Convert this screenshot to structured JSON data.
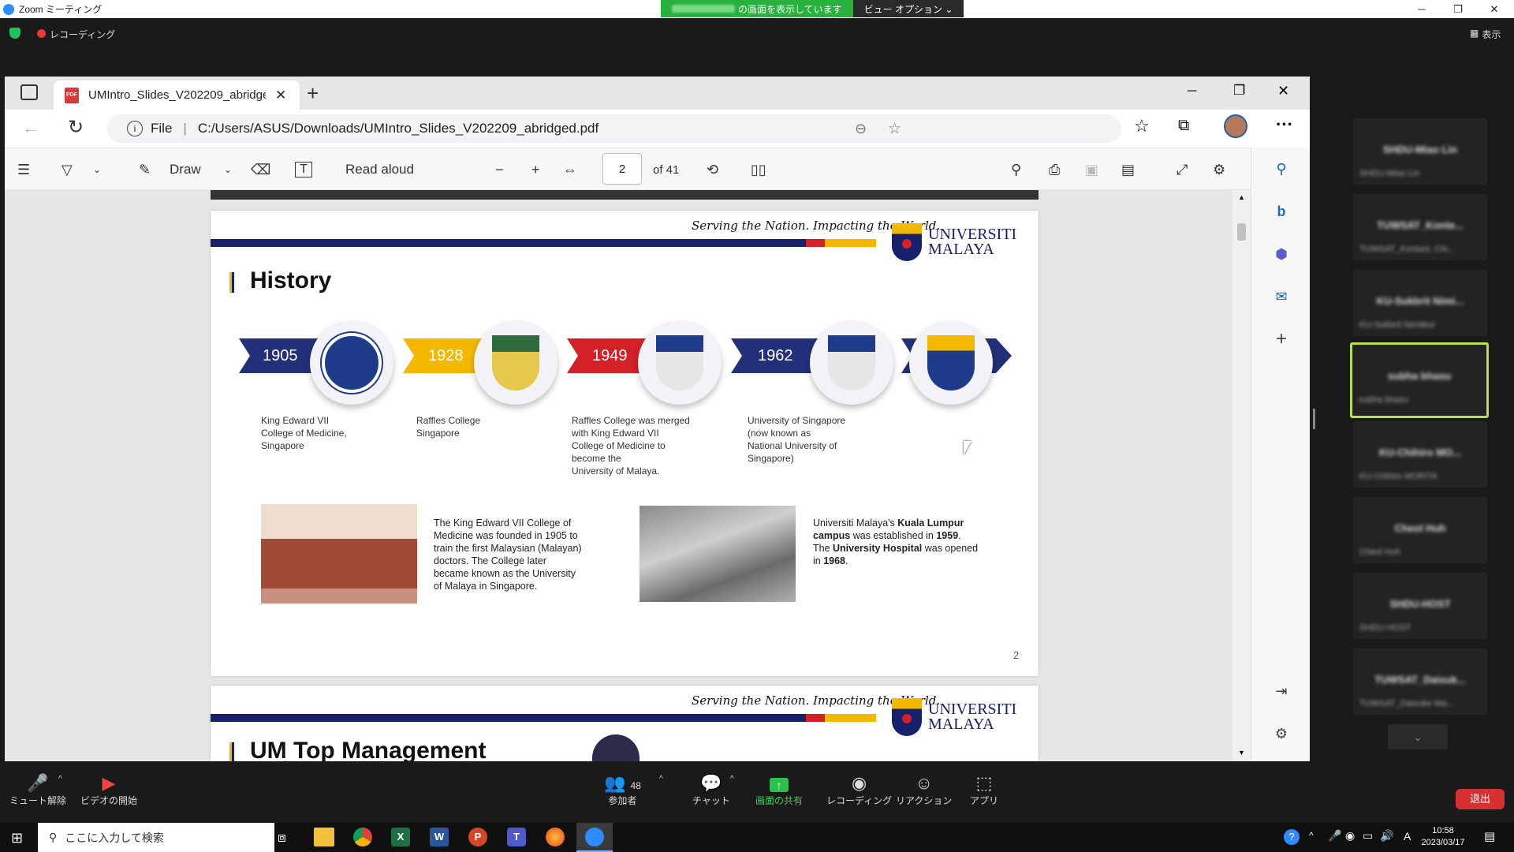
{
  "zoom": {
    "window_title": "Zoom ミーティング",
    "share_banner_suffix": "の画面を表示しています",
    "view_options": "ビュー オプション ⌄",
    "recording": "レコーディング",
    "view_label": "表示",
    "leave": "退出",
    "participants_count": "48",
    "toolbar": [
      {
        "label": "ミュート解除",
        "icon": "microphone-muted-icon"
      },
      {
        "label": "ビデオの開始",
        "icon": "video-off-icon"
      },
      {
        "label": "参加者",
        "icon": "participants-icon"
      },
      {
        "label": "チャット",
        "icon": "chat-icon"
      },
      {
        "label": "画面の共有",
        "icon": "share-screen-icon"
      },
      {
        "label": "レコーディング",
        "icon": "record-icon"
      },
      {
        "label": "リアクション",
        "icon": "reaction-icon"
      },
      {
        "label": "アプリ",
        "icon": "apps-icon"
      }
    ],
    "participants": [
      {
        "name": "SHDU-Miao Lin",
        "sub": "SHDU-Miao Lin"
      },
      {
        "name": "TUWSAT_Konte...",
        "sub": "TUWSAT_Kontani, Chi..."
      },
      {
        "name": "KU-Sukbrit  Nimi...",
        "sub": "KU-Sukbrit Nimitkul"
      },
      {
        "name": "subha bhasu",
        "sub": "subha bhasu"
      },
      {
        "name": "KU-Chihiro  MO...",
        "sub": "KU-Chihiro MORITA"
      },
      {
        "name": "Cheol Huh",
        "sub": "Cheol Huh"
      },
      {
        "name": "SHDU-HOST",
        "sub": "SHDU-HOST"
      },
      {
        "name": "TUWSAT_Daisuk...",
        "sub": "TUWSAT_Daisuke Wa..."
      }
    ]
  },
  "browser": {
    "tab_title": "UMIntro_Slides_V202209_abridged.pdf",
    "url_prefix": "File",
    "url": "C:/Users/ASUS/Downloads/UMIntro_Slides_V202209_abridged.pdf",
    "pdf_toolbar": {
      "draw": "Draw",
      "read_aloud": "Read aloud",
      "page": "2",
      "of_pages": "of 41"
    }
  },
  "slide1": {
    "motto": "Serving the Nation. Impacting the World.",
    "logo_line1": "UNIVERSITI",
    "logo_line2": "MALAYA",
    "title": "History",
    "timeline": [
      {
        "year": "1905",
        "caption": [
          "King Edward VII",
          "College of Medicine,",
          "Singapore"
        ]
      },
      {
        "year": "1928",
        "caption": [
          "Raffles College",
          "Singapore"
        ]
      },
      {
        "year": "1949",
        "caption": [
          "Raffles College was merged",
          "with King Edward VII",
          "College of Medicine to",
          "become the",
          "University of Malaya."
        ]
      },
      {
        "year": "1962",
        "caption": [
          "University of Singapore",
          "(now known as",
          "National University of",
          "Singapore)"
        ]
      }
    ],
    "para1": [
      "The King Edward VII College of",
      "Medicine was founded in 1905 to",
      "train the first Malaysian (Malayan)",
      "doctors.  The College later",
      "became known as the University",
      "of Malaya in Singapore."
    ],
    "para2": {
      "a": "Universiti Malaya's ",
      "b": "Kuala Lumpur",
      "c": "campus",
      "d": " was established in ",
      "e": "1959",
      "f": ".",
      "g": "The ",
      "h": "University Hospital",
      "i": " was opened",
      "j": "in ",
      "k": "1968",
      "l": "."
    },
    "page_number": "2"
  },
  "slide2": {
    "motto": "Serving the Nation. Impacting the World.",
    "logo_line1": "UNIVERSITI",
    "logo_line2": "MALAYA",
    "title": "UM Top Management"
  },
  "taskbar": {
    "search_placeholder": "ここに入力して検索",
    "time": "10:58",
    "date": "2023/03/17",
    "ime": "A"
  }
}
